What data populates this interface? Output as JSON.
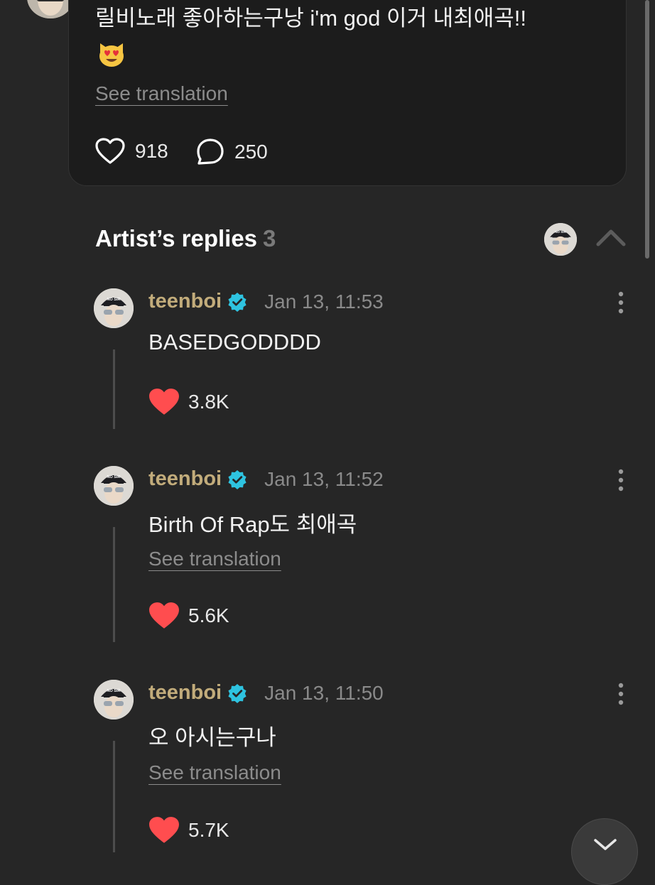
{
  "post": {
    "text": "릴비노래 좋아하는구낭 i'm god 이거 내최애곡!!",
    "emoji": "smiling-cat-heart-eyes",
    "see_translation": "See translation",
    "likes": "918",
    "comments": "250"
  },
  "artist_replies": {
    "title": "Artist’s replies",
    "count": "3",
    "items": [
      {
        "name": "teenboi",
        "time": "Jan 13, 11:53",
        "text": "BASEDGODDDD",
        "likes": "3.8K",
        "see_translation": ""
      },
      {
        "name": "teenboi",
        "time": "Jan 13, 11:52",
        "text": "Birth Of Rap도 최애곡",
        "likes": "5.6K",
        "see_translation": "See translation"
      },
      {
        "name": "teenboi",
        "time": "Jan 13, 11:50",
        "text": "오 아시는구나",
        "likes": "5.7K",
        "see_translation": "See translation"
      }
    ]
  },
  "avatar_cap_text": "NO SIR",
  "colors": {
    "background": "#262626",
    "card": "#1c1c1c",
    "artist_name": "#c2ac7b",
    "verified": "#2ec3e0",
    "like_filled": "#ff4d4f",
    "muted_text": "#8a8a8a"
  }
}
